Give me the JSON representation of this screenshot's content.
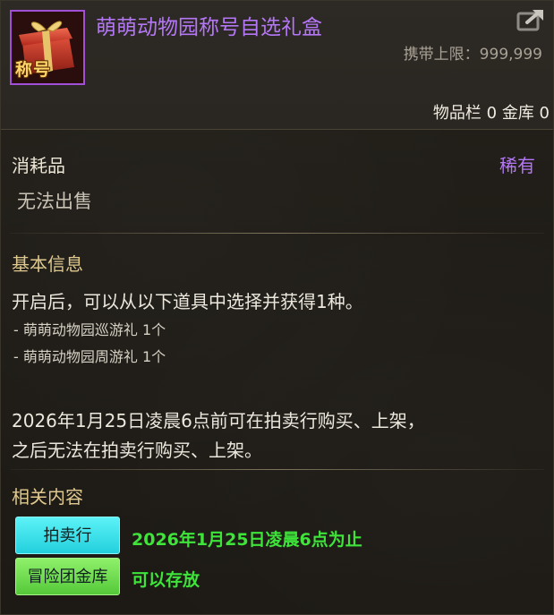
{
  "item": {
    "title": "萌萌动物园称号自选礼盒",
    "icon_label": "称号",
    "icon_name": "gift-box-icon",
    "carry_limit": "携带上限：999,999",
    "inventory": "物品栏 0 金库 0"
  },
  "header": {
    "share_icon": "share-icon"
  },
  "meta": {
    "category": "消耗品",
    "rarity": "稀有",
    "sell_status": "无法出售"
  },
  "basic_info": {
    "title": "基本信息",
    "description": "开启后，可以从以下道具中选择并获得1种。",
    "options": [
      "- 萌萌动物园巡游礼 1个",
      "- 萌萌动物园周游礼 1个"
    ],
    "trade_line_1": "2026年1月25日凌晨6点前可在拍卖行购买、上架，",
    "trade_line_2": "之后无法在拍卖行购买、上架。"
  },
  "related": {
    "title": "相关内容",
    "tags": [
      {
        "label": "拍卖行",
        "value": "2026年1月25日凌晨6点为止"
      },
      {
        "label": "冒险团金库",
        "value": "可以存放"
      }
    ]
  },
  "colors": {
    "rarity": "#b477f5",
    "auction_tag": "#23d0dd",
    "vault_tag": "#55c93a",
    "tag_value": "#3ee43a"
  }
}
